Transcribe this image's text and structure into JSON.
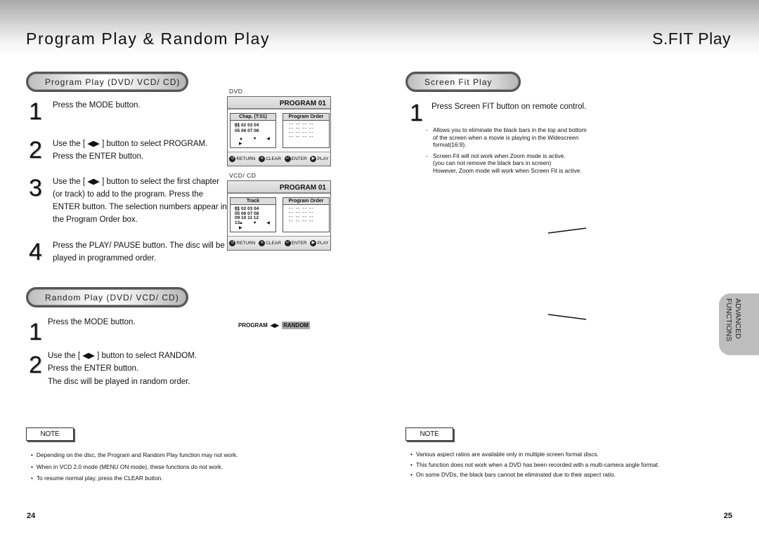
{
  "header": {
    "left_title": "Program Play & Random Play",
    "right_title": "S.FIT Play"
  },
  "program_play": {
    "section_label": "Program Play (DVD/ VCD/ CD)",
    "steps": [
      {
        "num": "1",
        "lines": [
          "Press the MODE button."
        ]
      },
      {
        "num": "2",
        "lines": [
          "Use the [ ◀▶ ] button to select PROGRAM.",
          "Press the ENTER button."
        ]
      },
      {
        "num": "3",
        "lines": [
          "Use the [ ◀▶ ] button to select the first chapter",
          "(or track) to add to the program. Press the",
          "ENTER button. The selection numbers appear in",
          "the Program Order box."
        ]
      },
      {
        "num": "4",
        "lines": [
          "Press the PLAY/ PAUSE button. The disc will be",
          "played in programmed order."
        ]
      }
    ],
    "screens": [
      {
        "label": "DVD",
        "header": "PROGRAM  01",
        "left_header": "Chap.  (T:01)",
        "numbers": [
          [
            "01",
            "02",
            "03",
            "04"
          ],
          [
            "05",
            "06",
            "07",
            "08"
          ]
        ],
        "right_header": "Program Order",
        "arrows": "▲ ▼ ◀ ▶",
        "footer": [
          "RETURN",
          "CLEAR",
          "ENTER",
          "PLAY"
        ]
      },
      {
        "label": "VCD/ CD",
        "header": "PROGRAM  01",
        "left_header": "Track",
        "numbers": [
          [
            "01",
            "02",
            "03",
            "04"
          ],
          [
            "05",
            "06",
            "07",
            "08"
          ],
          [
            "09",
            "10",
            "11",
            "12"
          ],
          [
            "13"
          ]
        ],
        "right_header": "Program Order",
        "arrows": "▲ ▼ ◀ ▶",
        "footer": [
          "RETURN",
          "CLEAR",
          "ENTER",
          "PLAY"
        ]
      }
    ]
  },
  "random_play": {
    "section_label": "Random Play (DVD/ VCD/ CD)",
    "steps": [
      {
        "num": "1",
        "lines": [
          "Press the MODE button."
        ]
      },
      {
        "num": "2",
        "lines": [
          "Use the [ ◀▶ ] button to select RANDOM.",
          "Press the ENTER button."
        ]
      }
    ],
    "result": "The disc will be played in random order.",
    "mode_indicator": {
      "left": "PROGRAM",
      "arrows": "◀▶",
      "selected": "RANDOM"
    }
  },
  "left_note": {
    "label": "NOTE",
    "items": [
      "Depending on the disc, the Program and Random Play function may not work.",
      "When in VCD 2.0 mode (MENU ON mode), these functions do not work.",
      "To resume normal play, press the CLEAR button."
    ]
  },
  "screen_fit": {
    "section_label": "Screen Fit Play",
    "step": {
      "num": "1",
      "text": "Press Screen FIT button on remote control."
    },
    "details": [
      "Allows you to eliminate the black bars in the top and bottom\nof the screen when a movie is playing in the Widescreen\nformat(16:9).",
      "Screen Fit will not work when Zoom mode is active.\n(you can not remove the black bars in screen)\nHowever, Zoom mode will work when Screen Fit is active."
    ]
  },
  "right_note": {
    "label": "NOTE",
    "items": [
      "Various aspect ratios are available only in multiple screen format discs.",
      "This function does not work when a DVD has been recorded with a multi-camera angle format.",
      "On some DVDs, the black bars cannot be eliminated due to their aspect ratio."
    ]
  },
  "side_tab": {
    "line1": "ADVANCED",
    "line2": "FUNCTIONS"
  },
  "page_numbers": {
    "left": "24",
    "right": "25"
  }
}
